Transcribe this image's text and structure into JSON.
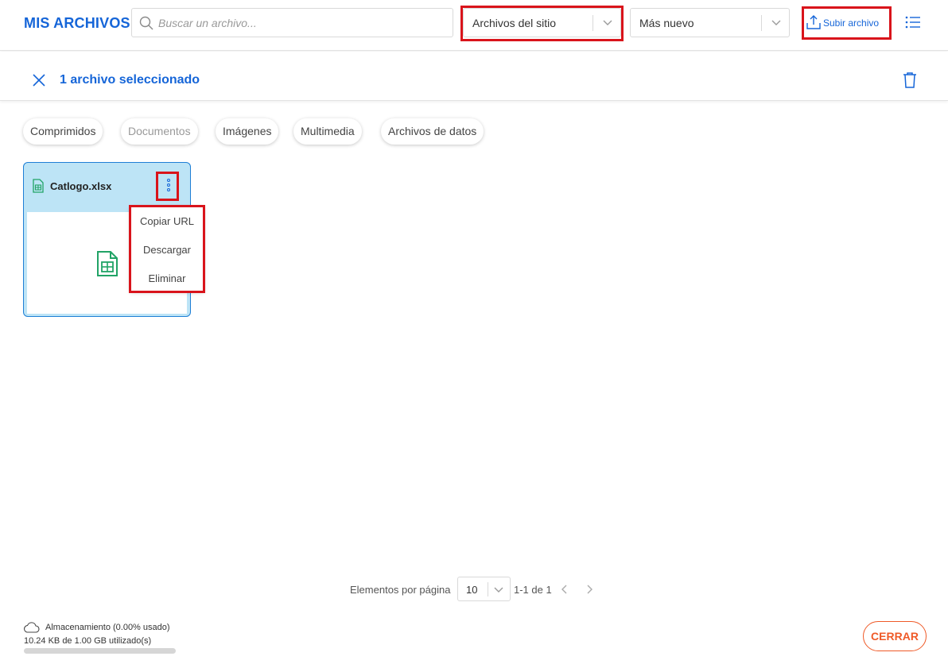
{
  "header": {
    "title": "MIS ARCHIVOS",
    "search_placeholder": "Buscar un archivo...",
    "source_select": "Archivos del sitio",
    "sort_select": "Más nuevo",
    "upload_label": "Subir archivo"
  },
  "selection": {
    "text": "1 archivo seleccionado"
  },
  "filters": [
    {
      "label": "Comprimidos",
      "enabled": true
    },
    {
      "label": "Documentos",
      "enabled": false
    },
    {
      "label": "Imágenes",
      "enabled": true
    },
    {
      "label": "Multimedia",
      "enabled": true
    },
    {
      "label": "Archivos de datos",
      "enabled": true
    }
  ],
  "file": {
    "name": "Catlogo.xlsx",
    "selected": true
  },
  "context_menu": [
    {
      "label": "Copiar URL"
    },
    {
      "label": "Descargar"
    },
    {
      "label": "Eliminar"
    }
  ],
  "pagination": {
    "label": "Elementos por página",
    "per_page": "10",
    "range": "1-1 de 1"
  },
  "storage": {
    "label": "Almacenamiento (0.00% usado)",
    "usage": "10.24 KB de 1.00 GB utilizado(s)",
    "percent_used": 0.0
  },
  "footer": {
    "close_label": "CERRAR"
  },
  "colors": {
    "accent": "#1565d8",
    "highlight": "#d9141b",
    "selected_card": "#bde4f6",
    "close_button": "#ef5a28",
    "spreadsheet_icon": "#21a366"
  }
}
